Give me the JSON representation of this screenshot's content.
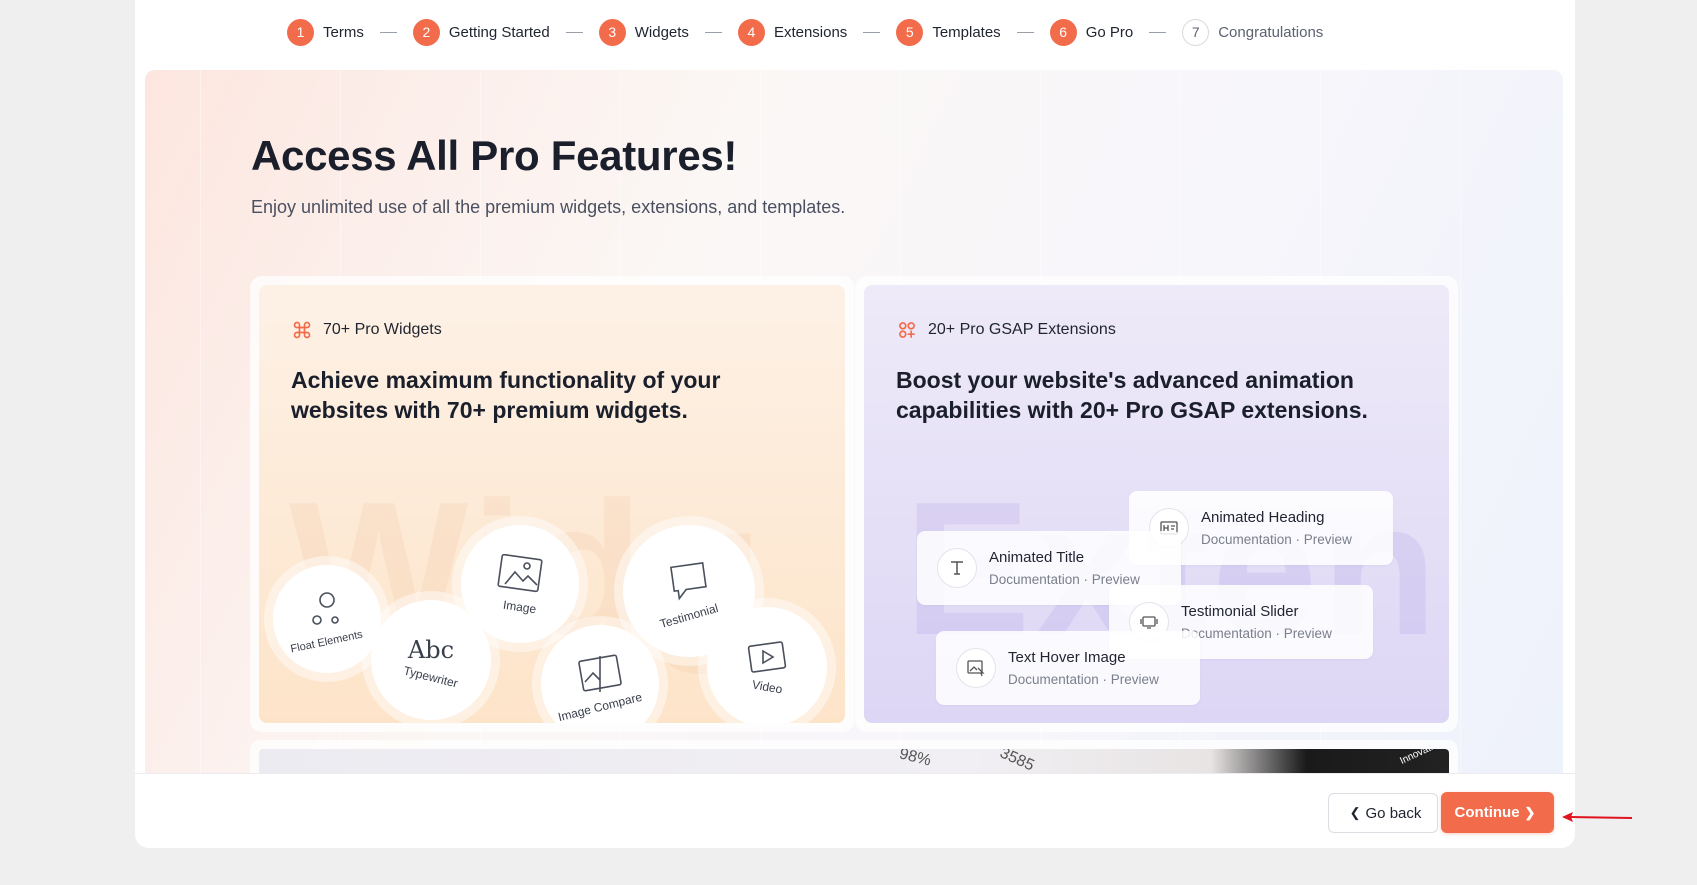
{
  "stepper": {
    "steps": [
      {
        "num": "1",
        "label": "Terms"
      },
      {
        "num": "2",
        "label": "Getting Started"
      },
      {
        "num": "3",
        "label": "Widgets"
      },
      {
        "num": "4",
        "label": "Extensions"
      },
      {
        "num": "5",
        "label": "Templates"
      },
      {
        "num": "6",
        "label": "Go Pro"
      },
      {
        "num": "7",
        "label": "Congratulations"
      }
    ]
  },
  "hero": {
    "title": "Access All Pro Features!",
    "subtitle": "Enjoy unlimited use of all the premium widgets, extensions, and templates."
  },
  "card_widgets": {
    "tag": "70+ Pro Widgets",
    "tag_icon": "command-icon",
    "heading": "Achieve maximum functionality of your websites with 70+ premium widgets.",
    "bubbles": [
      "Float Elements",
      "Typewriter",
      "Image",
      "Image Compare",
      "Testimonial",
      "Video"
    ]
  },
  "card_extensions": {
    "tag": "20+ Pro GSAP Extensions",
    "tag_icon": "apps-add-icon",
    "heading": "Boost your website's advanced animation capabilities with 20+ Pro GSAP extensions.",
    "features": [
      {
        "title": "Animated Heading",
        "links": "Documentation · Preview"
      },
      {
        "title": "Animated Title",
        "links": "Documentation · Preview"
      },
      {
        "title": "Testimonial Slider",
        "links": "Documentation · Preview"
      },
      {
        "title": "Text Hover Image",
        "links": "Documentation · Preview"
      }
    ]
  },
  "strip": {
    "values": [
      "98%",
      "3585",
      "Innovati"
    ]
  },
  "footer": {
    "back_label": "Go back",
    "continue_label": "Continue"
  },
  "colors": {
    "accent": "#f26b4a",
    "annotation_arrow": "#e0141e"
  }
}
